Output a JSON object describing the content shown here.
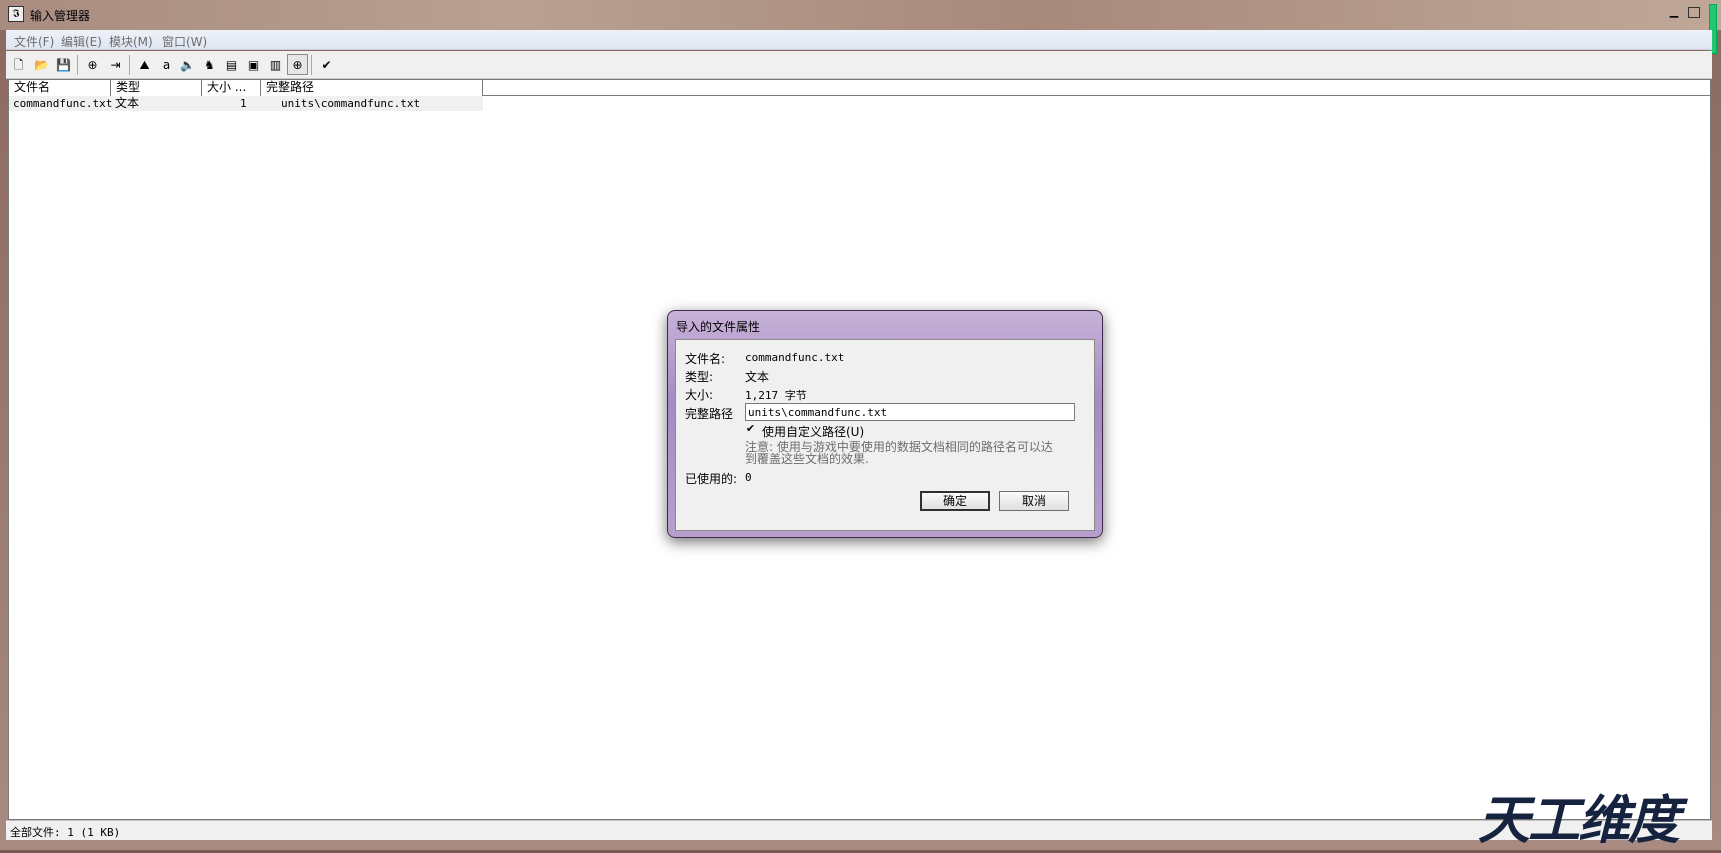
{
  "window": {
    "title": "输入管理器"
  },
  "menubar": {
    "items": [
      "文件(F)",
      "编辑(E)",
      "模块(M)",
      "窗口(W)"
    ]
  },
  "toolbar": {
    "buttons": [
      {
        "icon": "new-file-icon",
        "glyph": "🗋"
      },
      {
        "icon": "open-folder-icon",
        "glyph": "📂"
      },
      {
        "icon": "save-icon",
        "glyph": "💾"
      },
      {
        "icon": "import-file-icon",
        "glyph": "⊕"
      },
      {
        "icon": "export-file-icon",
        "glyph": "⇥"
      },
      {
        "icon": "terrain-editor-icon",
        "glyph": "⛰"
      },
      {
        "icon": "unit-editor-icon",
        "glyph": "a"
      },
      {
        "icon": "sound-editor-icon",
        "glyph": "🔈"
      },
      {
        "icon": "trigger-editor-icon",
        "glyph": "♞"
      },
      {
        "icon": "object-editor-icon",
        "glyph": "▤"
      },
      {
        "icon": "ai-editor-icon",
        "glyph": "▣"
      },
      {
        "icon": "campaign-editor-icon",
        "glyph": "▥"
      },
      {
        "icon": "import-manager-icon",
        "glyph": "⊕"
      },
      {
        "icon": "test-map-icon",
        "glyph": "✔"
      }
    ]
  },
  "list": {
    "columns": [
      "文件名",
      "类型",
      "大小 ...",
      "完整路径"
    ],
    "rows": [
      {
        "name": "commandfunc.txt",
        "type": "文本",
        "size": "1",
        "path": "units\\commandfunc.txt"
      }
    ]
  },
  "statusbar": {
    "text": "全部文件: 1 (1 KB)"
  },
  "dialog": {
    "title": "导入的文件属性",
    "filename_label": "文件名:",
    "filename_value": "commandfunc.txt",
    "type_label": "类型:",
    "type_value": "文本",
    "size_label": "大小:",
    "size_value": "1,217 字节",
    "path_label": "完整路径",
    "path_value": "units\\commandfunc.txt",
    "custom_path_checked": true,
    "custom_path_label": "使用自定义路径(U)",
    "note": "注意: 使用与游戏中要使用的数据文档相同的路径名可以达到覆盖这些文档的效果.",
    "used_label": "已使用的:",
    "used_value": "0",
    "ok_label": "确定",
    "cancel_label": "取消"
  },
  "watermark": {
    "text": "天工维度"
  }
}
